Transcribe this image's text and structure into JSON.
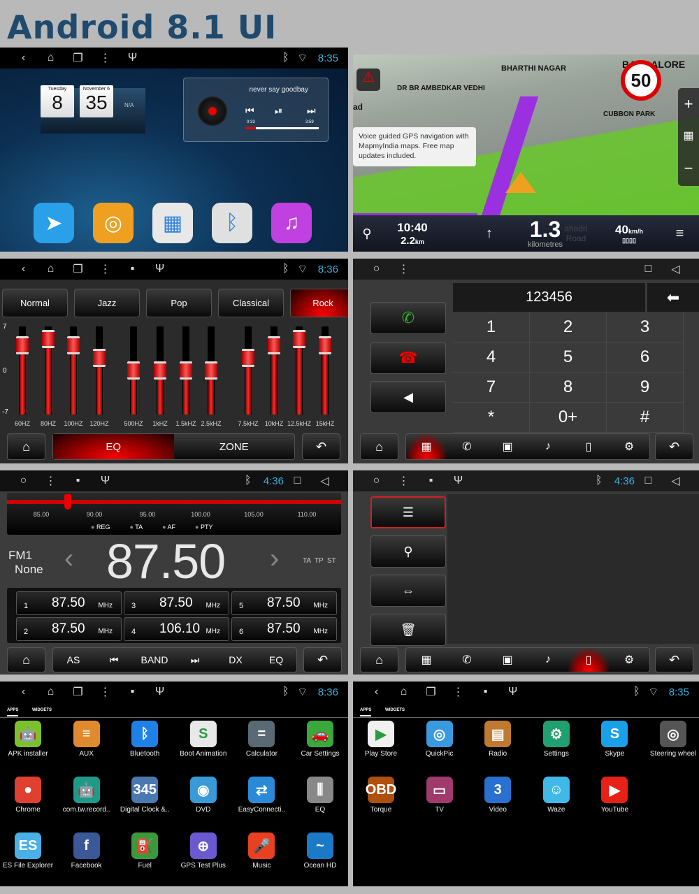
{
  "title": "Android 8.1 UI",
  "colors": {
    "clock": "#3ab0e0",
    "accent_red": "#e00000",
    "title": "#1f4a6e",
    "call_green": "#2db82d",
    "route_purple": "#9b30e0",
    "map_green": "#66c22f"
  },
  "home": {
    "status": {
      "left": [
        "back",
        "home",
        "recents",
        "menu",
        "usb"
      ],
      "right": [
        "bluetooth",
        "wifi"
      ],
      "time": "8:35"
    },
    "clock_widget": {
      "day": "Tuesday",
      "hour": "8",
      "date": "November 6",
      "minute": "35",
      "weather": "N/A"
    },
    "music_widget": {
      "song": "never say goodbay",
      "elapsed": "0:33",
      "duration": "3:59",
      "progress": 0.14
    },
    "dock": [
      {
        "icon": "navigation-compass-icon",
        "color": "#2aa0e8"
      },
      {
        "icon": "music-disc-icon",
        "color": "#f0a020"
      },
      {
        "icon": "apps-grid-icon",
        "color": "#e8e8e8"
      },
      {
        "icon": "bluetooth-icon",
        "color": "#e0e0e0"
      },
      {
        "icon": "music-note-icon",
        "color": "#c040e0"
      }
    ]
  },
  "navigation": {
    "places": {
      "flag_place": "BHARTHI NAGAR",
      "left_place": "DR BR AMBEDKAR VEDHI",
      "park": "CUBBON PARK",
      "city": "BANGALORE",
      "road_fragment": "ad"
    },
    "speed_limit": "50",
    "tooltip": "Voice guided GPS navigation with MapmyIndia maps. Free map updates included.",
    "eta": "10:40",
    "remaining": "2.2",
    "remaining_unit": "km",
    "next_distance": "1.3",
    "next_unit": "kilometres",
    "street": "ahadri Road",
    "speed": "40",
    "speed_unit": "km/h",
    "route_progress": 0.36
  },
  "eq": {
    "status": {
      "left": [
        "back",
        "home",
        "recents",
        "menu",
        "image",
        "usb"
      ],
      "right": [
        "bluetooth",
        "wifi"
      ],
      "time": "8:36"
    },
    "presets": [
      "Normal",
      "Jazz",
      "Pop",
      "Classical",
      "Rock"
    ],
    "active_preset": "Rock",
    "scale": {
      "max": "7",
      "mid": "0",
      "min": "-7"
    },
    "bands": [
      {
        "label": "60HZ",
        "value": 4
      },
      {
        "label": "80HZ",
        "value": 5
      },
      {
        "label": "100HZ",
        "value": 4
      },
      {
        "label": "120HZ",
        "value": 2
      },
      {
        "label": "500HZ",
        "value": 0
      },
      {
        "label": "1kHZ",
        "value": 0
      },
      {
        "label": "1.5kHZ",
        "value": 0
      },
      {
        "label": "2.5kHZ",
        "value": 0
      },
      {
        "label": "7.5kHZ",
        "value": 2
      },
      {
        "label": "10kHZ",
        "value": 4
      },
      {
        "label": "12.5kHZ",
        "value": 5
      },
      {
        "label": "15kHZ",
        "value": 4
      }
    ],
    "tabs": [
      "EQ",
      "ZONE"
    ],
    "active_tab": "EQ"
  },
  "phone": {
    "status": {
      "left": [
        "circle",
        "menu"
      ],
      "right": [
        "square",
        "back-triangle"
      ],
      "time": ""
    },
    "number": "123456",
    "keys": [
      "1",
      "2",
      "3",
      "4",
      "5",
      "6",
      "7",
      "8",
      "9",
      "*",
      "0+",
      "#"
    ],
    "toolbar": [
      "dialpad",
      "call-log",
      "contacts",
      "music",
      "device",
      "settings"
    ],
    "active_tool": "dialpad"
  },
  "radio": {
    "status": {
      "left": [
        "circle",
        "menu",
        "image",
        "usb"
      ],
      "right": [
        "bluetooth"
      ],
      "time": "4:36"
    },
    "scale_labels": [
      "85.00",
      "90.00",
      "95.00",
      "100.00",
      "105.00",
      "110.00"
    ],
    "tuned": 87.5,
    "options": [
      "REG",
      "TA",
      "AF",
      "PTY"
    ],
    "band": "FM1",
    "ps": "None",
    "frequency": "87.50",
    "flags": "TA  TP  ST",
    "presets": [
      {
        "n": "1",
        "f": "87.50",
        "u": "MHz"
      },
      {
        "n": "2",
        "f": "87.50",
        "u": "MHz"
      },
      {
        "n": "3",
        "f": "87.50",
        "u": "MHz"
      },
      {
        "n": "4",
        "f": "106.10",
        "u": "MHz"
      },
      {
        "n": "5",
        "f": "87.50",
        "u": "MHz"
      },
      {
        "n": "6",
        "f": "87.50",
        "u": "MHz"
      }
    ],
    "controls": [
      "AS",
      "prev",
      "BAND",
      "next",
      "DX",
      "EQ"
    ]
  },
  "bt_device": {
    "status": {
      "left": [
        "circle",
        "menu",
        "image",
        "usb"
      ],
      "right": [
        "bluetooth"
      ],
      "time": "4:36"
    },
    "side_buttons": [
      "list",
      "search",
      "connect",
      "delete"
    ],
    "active_side": "list",
    "toolbar": [
      "dialpad",
      "call-log",
      "contacts",
      "music",
      "device",
      "settings"
    ],
    "active_tool": "device"
  },
  "apps1": {
    "status": {
      "left": [
        "back",
        "home",
        "recents",
        "menu",
        "image",
        "usb"
      ],
      "right": [
        "bluetooth",
        "wifi"
      ],
      "time": "8:36"
    },
    "tabs": [
      "APPS",
      "WIDGETS"
    ],
    "apps": [
      {
        "label": "APK installer",
        "glyph": "🤖",
        "color": "#7cc12c"
      },
      {
        "label": "AUX",
        "glyph": "≡",
        "color": "#e08a30"
      },
      {
        "label": "Bluetooth",
        "glyph": "ᛒ",
        "color": "#1f80e8"
      },
      {
        "label": "Boot Animation",
        "glyph": "S",
        "color": "#e8e8e8"
      },
      {
        "label": "Calculator",
        "glyph": "=",
        "color": "#5a6a74"
      },
      {
        "label": "Car Settings",
        "glyph": "🚗",
        "color": "#3aa83a"
      },
      {
        "label": "Chrome",
        "glyph": "●",
        "color": "#e04030"
      },
      {
        "label": "com.tw.record..",
        "glyph": "🤖",
        "color": "#1f9a88"
      },
      {
        "label": "Digital Clock &..",
        "glyph": "345",
        "color": "#4a78b0"
      },
      {
        "label": "DVD",
        "glyph": "◉",
        "color": "#3a9ad8"
      },
      {
        "label": "EasyConnecti..",
        "glyph": "⇄",
        "color": "#2a8ad8"
      },
      {
        "label": "EQ",
        "glyph": "⫼",
        "color": "#888888"
      },
      {
        "label": "ES File Explorer",
        "glyph": "ES",
        "color": "#4ab0e8"
      },
      {
        "label": "Facebook",
        "glyph": "f",
        "color": "#3b5998"
      },
      {
        "label": "Fuel",
        "glyph": "⛽",
        "color": "#3a9a3a"
      },
      {
        "label": "GPS Test Plus",
        "glyph": "⊕",
        "color": "#6a5ad0"
      },
      {
        "label": "Music",
        "glyph": "🎤",
        "color": "#e84020"
      },
      {
        "label": "Ocean HD",
        "glyph": "~",
        "color": "#1a7ac8"
      }
    ]
  },
  "apps2": {
    "status": {
      "left": [
        "back",
        "home",
        "recents",
        "menu",
        "image",
        "usb"
      ],
      "right": [
        "bluetooth",
        "wifi"
      ],
      "time": "8:35"
    },
    "tabs": [
      "APPS",
      "WIDGETS"
    ],
    "apps": [
      {
        "label": "Play Store",
        "glyph": "▶",
        "color": "#f0f0f0"
      },
      {
        "label": "QuickPic",
        "glyph": "◎",
        "color": "#3a9ae0"
      },
      {
        "label": "Radio",
        "glyph": "▤",
        "color": "#c07a30"
      },
      {
        "label": "Settings",
        "glyph": "⚙",
        "color": "#20a070"
      },
      {
        "label": "Skype",
        "glyph": "S",
        "color": "#1aa0e8"
      },
      {
        "label": "Steering wheel",
        "glyph": "◎",
        "color": "#555555"
      },
      {
        "label": "Torque",
        "glyph": "OBD",
        "color": "#b05010"
      },
      {
        "label": "TV",
        "glyph": "▭",
        "color": "#a03a6a"
      },
      {
        "label": "Video",
        "glyph": "3",
        "color": "#2a70d0"
      },
      {
        "label": "Waze",
        "glyph": "☺",
        "color": "#40b8e8"
      },
      {
        "label": "YouTube",
        "glyph": "▶",
        "color": "#e62117"
      }
    ]
  }
}
